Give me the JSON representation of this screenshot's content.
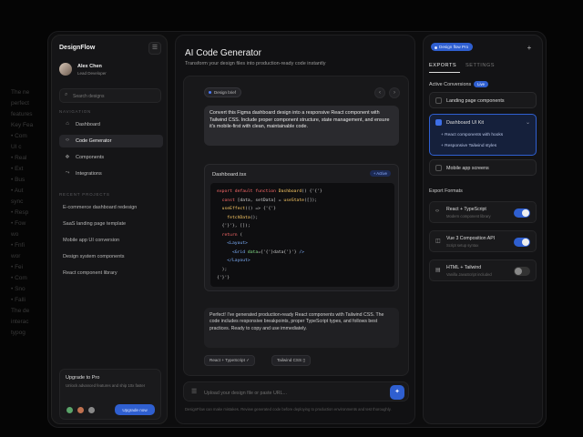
{
  "background_text": [
    "The ne",
    "perfect",
    "features",
    "Key Fea",
    "• Com",
    "UI c",
    "• Real",
    "• Ext",
    "• Bus",
    "• Aut",
    "sync",
    "• Resp",
    "• Fow",
    "wo",
    "• Fnfi",
    "wor",
    "• Fei",
    "• Com",
    "• Sno",
    "• Falli",
    "The de",
    "interac",
    "typog"
  ],
  "sidebar": {
    "logo": "DesignFlow",
    "menu_icon": "☰",
    "profile": {
      "name": "Alex Chen",
      "role": "Lead Developer"
    },
    "search_placeholder": "Search designs",
    "nav_label": "NAVIGATION",
    "nav_items": [
      {
        "icon": "⌂",
        "label": "Dashboard",
        "active": false
      },
      {
        "icon": "‹›",
        "label": "Code Generator",
        "active": true
      },
      {
        "icon": "❖",
        "label": "Components",
        "active": false
      },
      {
        "icon": "⤳",
        "label": "Integrations",
        "active": false
      }
    ],
    "projects_label": "RECENT PROJECTS",
    "projects": [
      "E-commerce dashboard redesign",
      "SaaS landing page template",
      "Mobile app UI conversion",
      "Design system components",
      "React component library"
    ],
    "upgrade": {
      "title": "Upgrade to Pro",
      "description": "Unlock advanced features and ship 10x faster",
      "button": "Upgrade now"
    }
  },
  "main": {
    "title": "AI Code Generator",
    "subtitle": "Transform your design files into production-ready code instantly",
    "chat": {
      "context_pill": "Design brief",
      "user_message": "Convert this Figma dashboard design into a responsive React component with Tailwind CSS. Include proper component structure, state management, and ensure it's mobile-first with clean, maintainable code.",
      "code": {
        "filename": "Dashboard.tsx",
        "badge": "+ Active"
      },
      "ai_message": "Perfect! I've generated production-ready React components with Tailwind CSS. The code includes responsive breakpoints, proper TypeScript types, and follows best practices. Ready to copy and use immediately.",
      "chips": [
        "React + TypeScript ✓",
        "Tailwind CSS ▯"
      ]
    },
    "composer_placeholder": "Upload your design file or paste URL...",
    "send_icon": "✦",
    "footnote": "DesignFlow can make mistakes. Review generated code before deploying to production environments and test thoroughly."
  },
  "right_panel": {
    "badge": "Design flow Pro",
    "plus_icon": "+",
    "tabs": [
      "EXPORTS",
      "SETTINGS"
    ],
    "active_conversions_label": "Active Conversions",
    "live_label": "Live",
    "conversions": [
      {
        "label": "Landing page components",
        "checked": false,
        "selected": false
      },
      {
        "label": "Dashboard UI Kit",
        "checked": true,
        "selected": true,
        "options": [
          "+ React components with hooks",
          "+ Responsive Tailwind styles"
        ]
      },
      {
        "label": "Mobile app screens",
        "checked": false,
        "selected": false
      }
    ],
    "export_formats_label": "Export Formats",
    "formats": [
      {
        "icon": "‹›",
        "title": "React + TypeScript",
        "desc": "Modern component library",
        "on": true
      },
      {
        "icon": "◫",
        "title": "Vue 3 Composition API",
        "desc": "Script setup syntax",
        "on": true
      },
      {
        "icon": "▤",
        "title": "HTML + Tailwind",
        "desc": "Vanilla JavaScript included",
        "on": false
      }
    ]
  },
  "colors": {
    "accent": "#2f5fd0",
    "background": "#0d0d0e"
  }
}
